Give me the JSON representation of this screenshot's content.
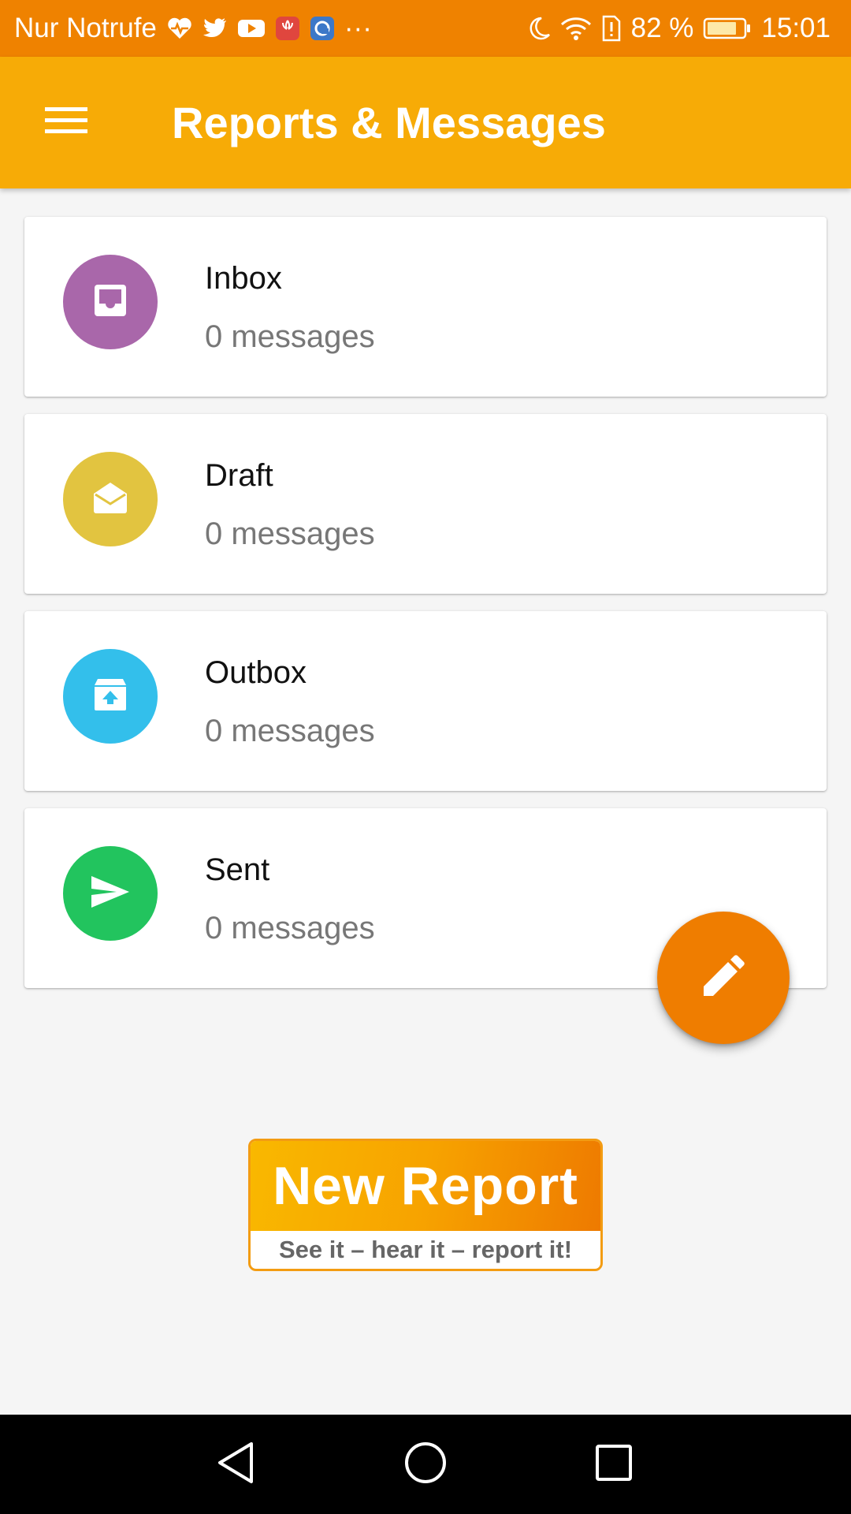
{
  "status_bar": {
    "carrier": "Nur Notrufe",
    "battery": "82 %",
    "time": "15:01",
    "more": "···",
    "icons": [
      "heart-monitor-icon",
      "twitter-icon",
      "youtube-icon",
      "huawei-app-icon",
      "app-icon",
      "moon-icon",
      "wifi-icon",
      "sim-alert-icon",
      "battery-icon"
    ]
  },
  "app_bar": {
    "title": "Reports & Messages",
    "menu_icon": "hamburger-icon"
  },
  "folders": [
    {
      "name": "Inbox",
      "count": "0 messages",
      "color": "#a967aa",
      "icon": "inbox-tray-icon"
    },
    {
      "name": "Draft",
      "count": "0 messages",
      "color": "#e2c440",
      "icon": "open-envelope-icon"
    },
    {
      "name": "Outbox",
      "count": "0 messages",
      "color": "#33bfeb",
      "icon": "outbox-upload-icon"
    },
    {
      "name": "Sent",
      "count": "0 messages",
      "color": "#22c45e",
      "icon": "send-icon"
    }
  ],
  "fab": {
    "icon": "pencil-icon",
    "color": "#ef7d00"
  },
  "banner": {
    "title": "New Report",
    "tagline": "See it – hear it – report it!"
  },
  "nav_bar": {
    "icons": [
      "back-triangle-icon",
      "home-circle-icon",
      "recents-square-icon"
    ]
  }
}
